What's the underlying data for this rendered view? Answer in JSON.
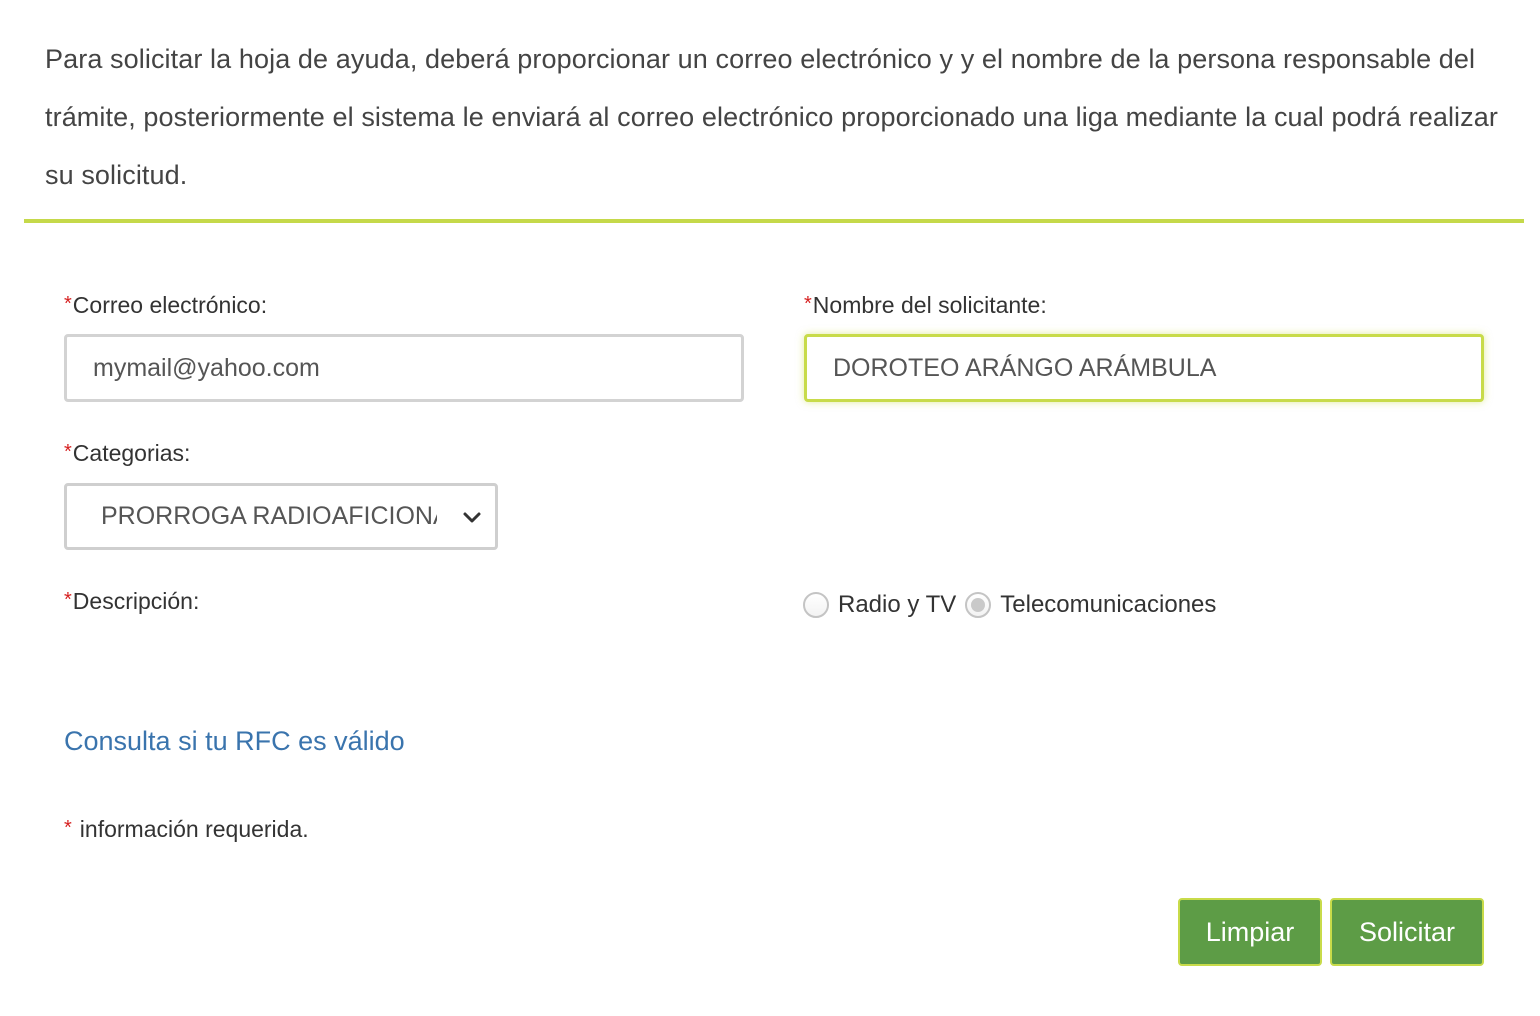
{
  "intro": {
    "text": "Para solicitar la hoja de ayuda, deberá proporcionar un correo electrónico y y el nombre de la persona responsable del trámite, posteriormente el sistema le enviará al correo electrónico proporcionado una liga mediante la cual podrá realizar su solicitud."
  },
  "required_marker": "*",
  "form": {
    "email": {
      "label": "Correo electrónico:",
      "value": "mymail@yahoo.com"
    },
    "name": {
      "label": "Nombre del solicitante:",
      "value": "DOROTEO ARÁNGO ARÁMBULA"
    },
    "category": {
      "label": "Categorias:",
      "selected": "PRORROGA RADIOAFICIONADO"
    },
    "description": {
      "label": "Descripción:"
    },
    "radios": [
      {
        "label": "Radio y TV",
        "checked": false
      },
      {
        "label": "Telecomunicaciones",
        "checked": true
      }
    ]
  },
  "link": {
    "label": "Consulta si tu RFC es válido"
  },
  "note": {
    "text": "información requerida."
  },
  "buttons": {
    "clear_label": "Limpiar",
    "submit_label": "Solicitar"
  },
  "colors": {
    "accent": "#c5d94a",
    "button": "#5d9c46",
    "link": "#3a74ad",
    "required": "#d62020"
  }
}
